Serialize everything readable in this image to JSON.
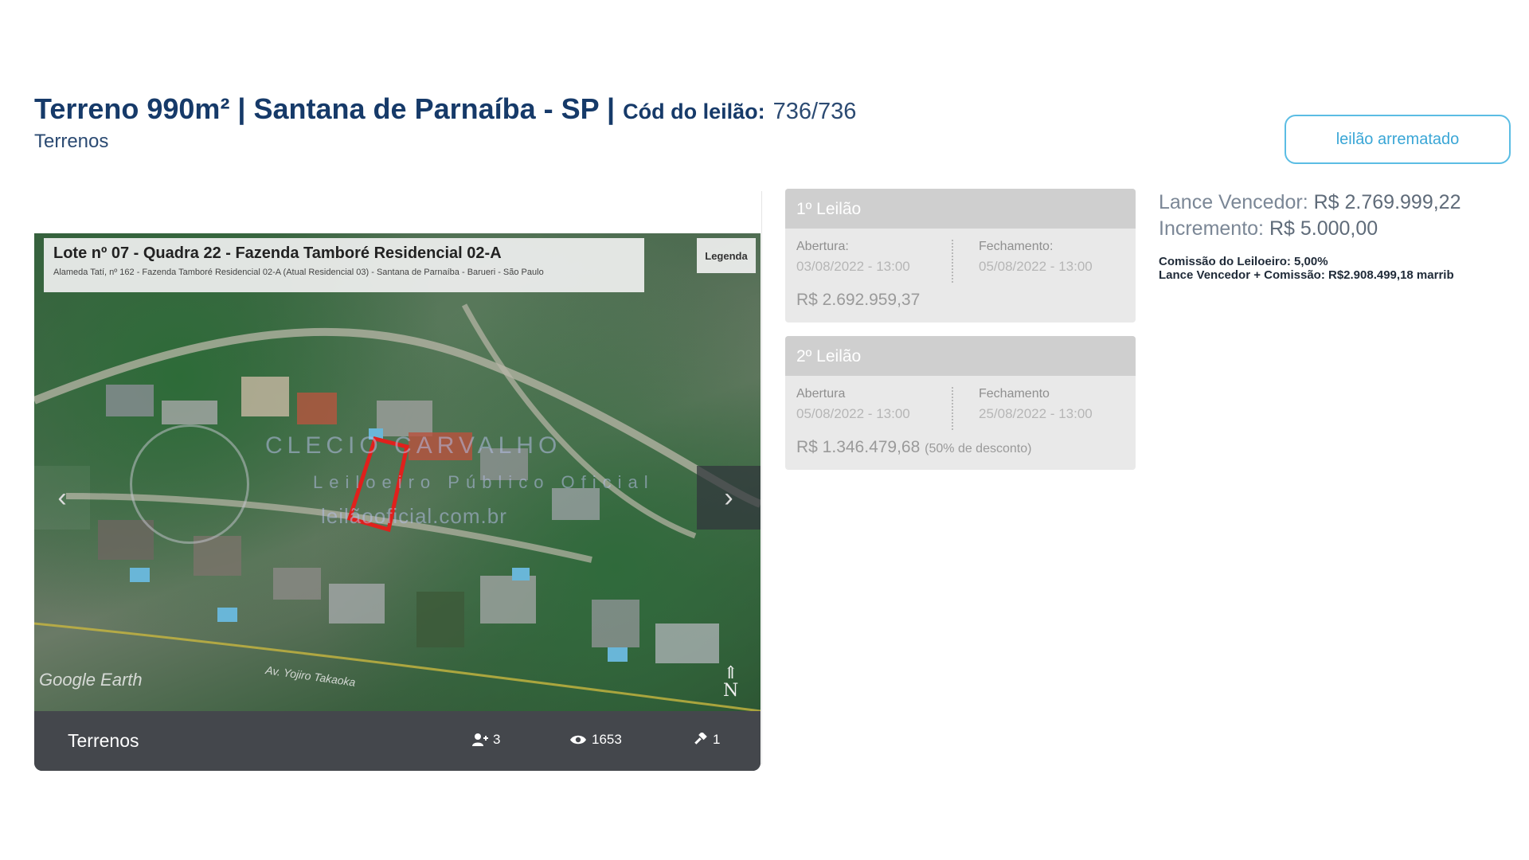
{
  "header": {
    "title": "Terreno 990m² | Santana de Parnaíba - SP |",
    "code_label": "Cód do leilão:",
    "code_value": "736/736",
    "category": "Terrenos",
    "status_button": "leilão arrematado"
  },
  "gallery": {
    "caption_title": "Lote nº 07 - Quadra 22 - Fazenda Tamboré Residencial 02-A",
    "caption_subtitle": "Alameda Tatí, nº 162 - Fazenda Tamboré Residencial 02-A (Atual Residencial 03) - Santana de Parnaíba - Barueri - São Paulo",
    "legend_label": "Legenda",
    "watermark_line1": "CLECIO CARVALHO",
    "watermark_line2": "Leiloeiro Público Oficial",
    "watermark_line3": "leilãooficial.com.br",
    "map_brand": "Google Earth",
    "road_label": "Av. Yojiro Takaoka",
    "north_label": "N",
    "bar_category": "Terrenos",
    "stats": {
      "participants": "3",
      "views": "1653",
      "bids": "1"
    }
  },
  "auctions": [
    {
      "title": "1º Leilão",
      "open_label": "Abertura:",
      "open_value": "03/08/2022 - 13:00",
      "close_label": "Fechamento:",
      "close_value": "05/08/2022 - 13:00",
      "price": "R$ 2.692.959,37",
      "discount": ""
    },
    {
      "title": "2º Leilão",
      "open_label": "Abertura",
      "open_value": "05/08/2022 - 13:00",
      "close_label": "Fechamento",
      "close_value": "25/08/2022 - 13:00",
      "price": "R$ 1.346.479,68",
      "discount": "(50% de desconto)"
    }
  ],
  "result": {
    "winning_label": "Lance Vencedor:",
    "winning_value": "R$ 2.769.999,22",
    "increment_label": "Incremento:",
    "increment_value": "R$ 5.000,00",
    "commission": "Comissão do Leiloeiro: 5,00%",
    "total": "Lance Vencedor + Comissão: R$2.908.499,18 marrib"
  },
  "colors": {
    "title": "#163a69",
    "accent": "#3aa6d6",
    "card_bg": "#e9e9e9",
    "card_head": "#cfcfcf",
    "gallery_bar": "#44474c",
    "lot_outline": "#e0201c"
  },
  "icons": {
    "participants": "user-plus-icon",
    "views": "eye-icon",
    "bids": "gavel-icon",
    "prev": "chevron-left-icon",
    "next": "chevron-right-icon"
  }
}
